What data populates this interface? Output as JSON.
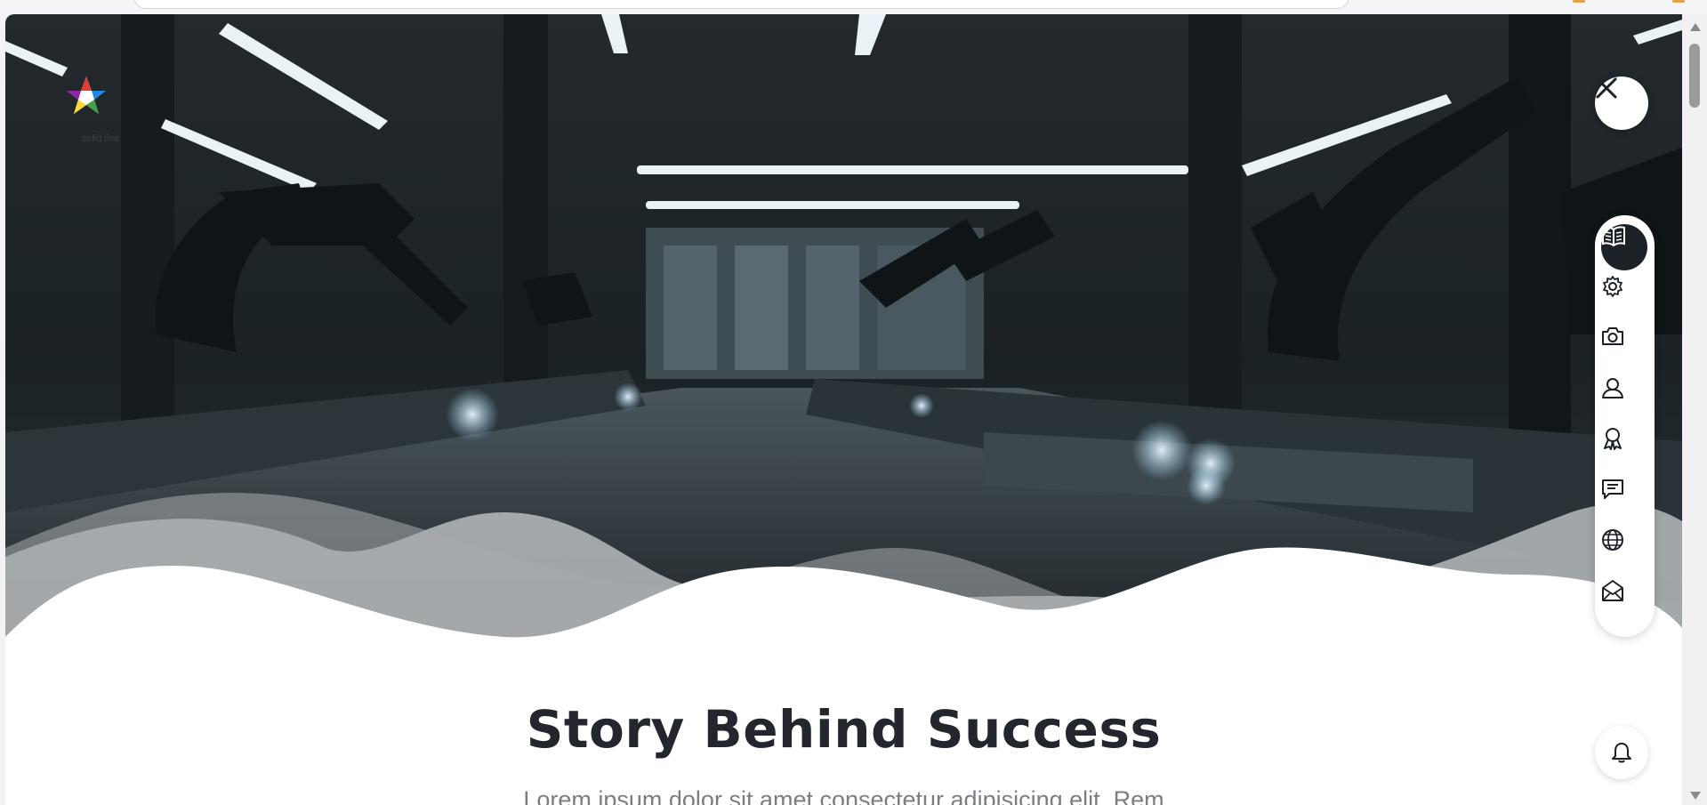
{
  "page": {
    "logo_text": "solid line",
    "headline": "Story Behind Success",
    "intro": "Lorem ipsum dolor sit amet consectetur adipisicing elit. Rem"
  },
  "hero": {
    "description_icon": "factory-robot-arms-photo"
  },
  "controls": {
    "close_icon": "close-icon",
    "notifications_icon": "bell-icon"
  },
  "side_nav": {
    "items": [
      {
        "icon": "book-icon",
        "active": true
      },
      {
        "icon": "gear-icon",
        "active": false
      },
      {
        "icon": "camera-icon",
        "active": false
      },
      {
        "icon": "user-icon",
        "active": false
      },
      {
        "icon": "award-icon",
        "active": false
      },
      {
        "icon": "chat-icon",
        "active": false
      },
      {
        "icon": "globe-icon",
        "active": false
      },
      {
        "icon": "mail-icon",
        "active": false
      }
    ]
  },
  "colors": {
    "accent": "#1c2128",
    "headline": "#23272d",
    "body_text": "#7a7e84"
  }
}
